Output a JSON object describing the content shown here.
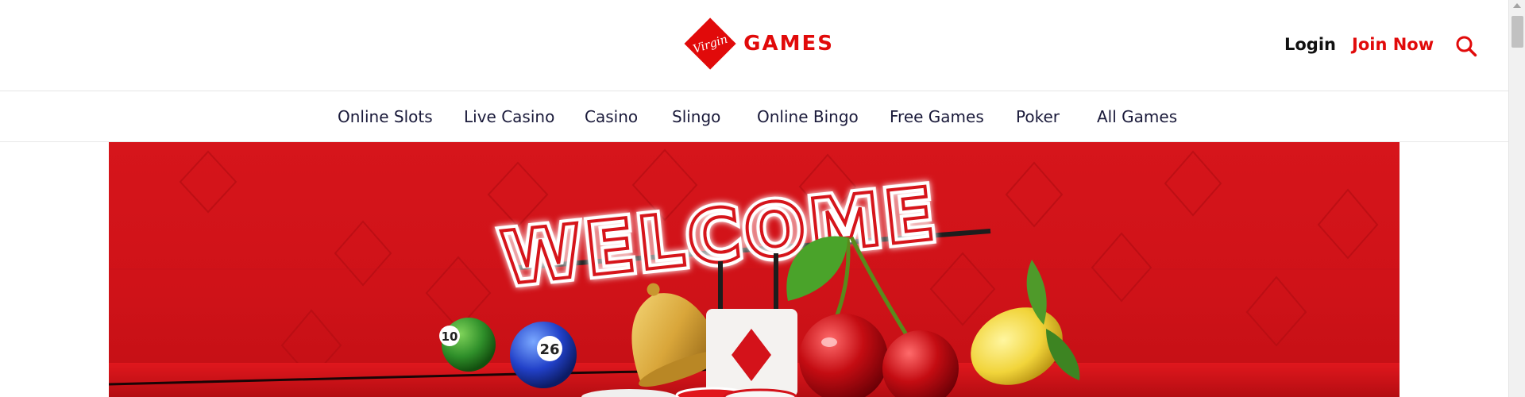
{
  "header": {
    "logo_script": "Virgin",
    "logo_text": "GAMES",
    "login_label": "Login",
    "join_label": "Join Now",
    "search_icon": "search-icon"
  },
  "nav": {
    "items": [
      {
        "label": "Online Slots"
      },
      {
        "label": "Live Casino"
      },
      {
        "label": "Casino"
      },
      {
        "label": "Slingo"
      },
      {
        "label": "Online Bingo"
      },
      {
        "label": "Free Games"
      },
      {
        "label": "Poker"
      },
      {
        "label": "All Games"
      }
    ]
  },
  "hero": {
    "neon_text": "WELCOME",
    "ball_green_number": "10",
    "ball_blue_number": "26"
  },
  "colors": {
    "brand_red": "#e10a0a",
    "nav_text": "#1a1a3a",
    "hero_red": "#d6151b"
  }
}
